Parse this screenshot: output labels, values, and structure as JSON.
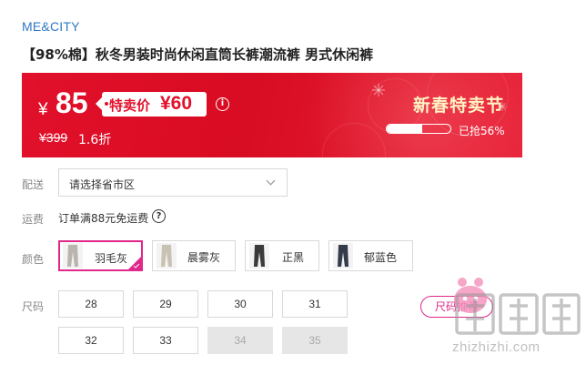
{
  "brand": "ME&CITY",
  "product_title": "【98%棉】秋冬男装时尚休闲直筒长裤潮流裤 男式休闲裤",
  "banner": {
    "currency": "¥",
    "price": "85",
    "sale_label": "特卖价",
    "sale_price": "¥60",
    "info_icon": "info-icon",
    "original_price": "¥399",
    "discount": "1.6折",
    "event_title": "新春特卖节",
    "progress_text": "已抢56%",
    "progress_fraction": 0.56,
    "color_primary": "#e2102b"
  },
  "delivery": {
    "label": "配送",
    "placeholder": "请选择省市区",
    "dropdown_icon": "chevron-down-icon"
  },
  "shipping": {
    "label": "运费",
    "text": "订单满88元免运费",
    "help_icon": "question-circle-icon"
  },
  "colors": {
    "label": "颜色",
    "options": [
      {
        "name": "羽毛灰",
        "selected": true,
        "swatch": "#b9b4ad"
      },
      {
        "name": "晨雾灰",
        "selected": false,
        "swatch": "#c8c2b2"
      },
      {
        "name": "正黑",
        "selected": false,
        "swatch": "#3a3a3a"
      },
      {
        "name": "郁蓝色",
        "selected": false,
        "swatch": "#343b4a"
      }
    ],
    "accent": "#e0288a"
  },
  "sizes": {
    "label": "尺码",
    "options": [
      {
        "value": "28",
        "available": true
      },
      {
        "value": "29",
        "available": true
      },
      {
        "value": "30",
        "available": true
      },
      {
        "value": "31",
        "available": true
      },
      {
        "value": "32",
        "available": true
      },
      {
        "value": "33",
        "available": true
      },
      {
        "value": "34",
        "available": false
      },
      {
        "value": "35",
        "available": false
      }
    ],
    "guide_label": "尺码推荐"
  },
  "watermark": {
    "text": "zhizhizhi.com"
  }
}
